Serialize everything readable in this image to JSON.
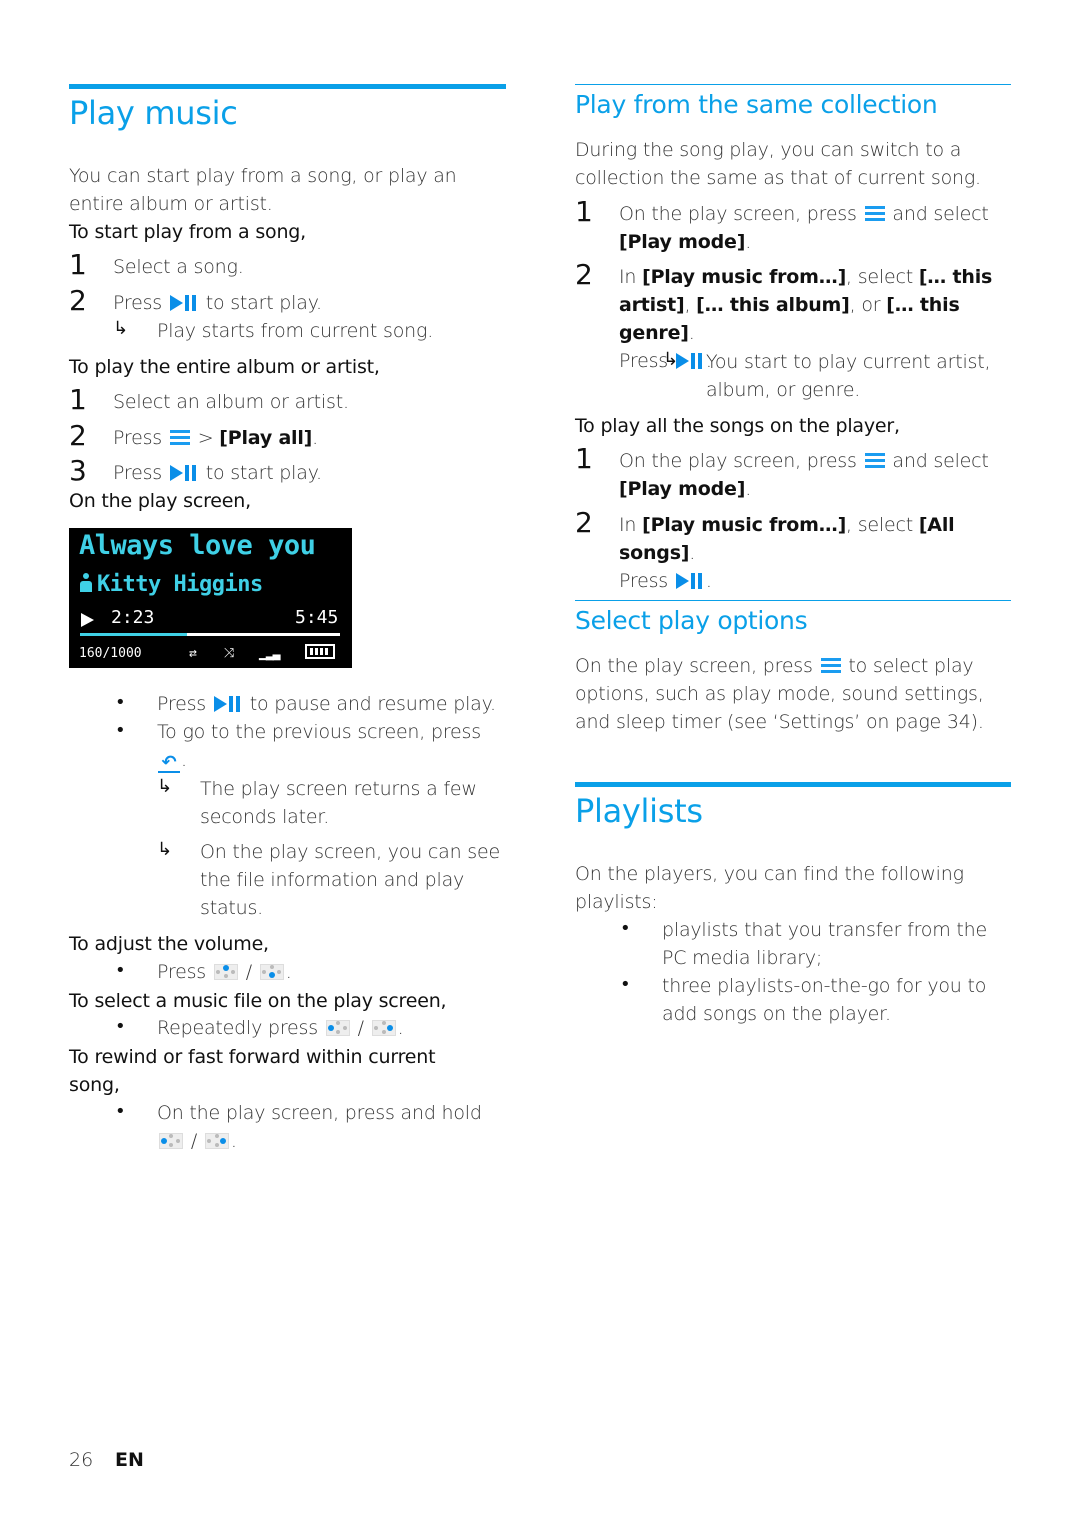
{
  "accent_color": "#0aa0e8",
  "left": {
    "title": "Play music",
    "intro": "You can start play from a song, or play an entire album or artist.",
    "song_heading": "To start play from a song,",
    "song_steps": [
      {
        "num": "1",
        "text": "Select a song."
      },
      {
        "num": "2",
        "pre": "Press",
        "icon": "play-pause-icon",
        "post": "to start play."
      }
    ],
    "song_result": "Play starts from current song.",
    "album_heading": "To play the entire album or artist,",
    "album_steps": [
      {
        "num": "1",
        "text": "Select an album or artist."
      },
      {
        "num": "2",
        "pre": "Press",
        "icon": "menu-icon",
        "mid": ">",
        "option": "[Play all]",
        "post": "."
      },
      {
        "num": "3",
        "pre": "Press",
        "icon": "play-pause-icon",
        "post": "to start play."
      }
    ],
    "play_screen_heading": "On the play screen,",
    "player_screen": {
      "song_title": "Always love you",
      "artist": "Kitty Higgins",
      "elapsed": "2:23",
      "total": "5:45",
      "progress_fraction": 0.41,
      "track_position": "160/1000",
      "status_icons": [
        "repeat-icon",
        "shuffle-icon",
        "equalizer-icon",
        "battery-icon"
      ]
    },
    "play_screen_bullets": [
      {
        "pre": "Press",
        "icon": "play-pause-icon",
        "post": "to pause and resume play."
      },
      {
        "pre": "To go to the previous screen, press",
        "icon": "back-icon",
        "post": "."
      }
    ],
    "play_screen_results": [
      "The play screen returns a few seconds later.",
      "On the play screen, you can see the file information and play status."
    ],
    "volume_heading": "To adjust the volume,",
    "volume_bullet": {
      "pre": "Press",
      "sep": "/",
      "post": "."
    },
    "select_heading": "To select a music file on the play screen,",
    "select_bullet": {
      "pre": "Repeatedly press",
      "sep": "/",
      "post": "."
    },
    "rewind_heading": "To rewind or fast forward within current song,",
    "rewind_bullet": {
      "pre": "On the play screen, press and hold",
      "sep": "/",
      "post": "."
    }
  },
  "right": {
    "collection_title": "Play from the same collection",
    "collection_intro": "During the song play, you can switch to a collection the same as that of current song.",
    "collection_step1": {
      "num": "1",
      "pre": "On the play screen, press",
      "post": "and select",
      "option": "[Play mode]"
    },
    "collection_step2": {
      "num": "2",
      "pre": "In",
      "option1": "[Play music from…]",
      "mid": ", select",
      "option2": "[… this artist]",
      "option3": "[… this album]",
      "or": ", or",
      "option4": "[… this genre]",
      "press": "Press"
    },
    "collection_result": "You start to play current artist, album, or genre.",
    "allsongs_heading": "To play all the songs on the player,",
    "allsongs_step1": {
      "num": "1",
      "pre": "On the play screen, press",
      "post": "and select",
      "option": "[Play mode]"
    },
    "allsongs_step2": {
      "num": "2",
      "pre": "In",
      "option1": "[Play music from…]",
      "mid": ", select",
      "option2": "[All songs]",
      "press": "Press"
    },
    "options_title": "Select play options",
    "options_text_pre": "On the play screen, press",
    "options_text_post": "to select play options, such as play mode, sound settings, and sleep timer (see ‘Settings’ on page 34).",
    "playlists_title": "Playlists",
    "playlists_intro": "On the players, you can find the following playlists:",
    "playlists_bullets": [
      "playlists that you transfer from the PC media library;",
      "three playlists-on-the-go for you to add songs on the player."
    ]
  },
  "footer": {
    "page_number": "26",
    "language": "EN"
  }
}
